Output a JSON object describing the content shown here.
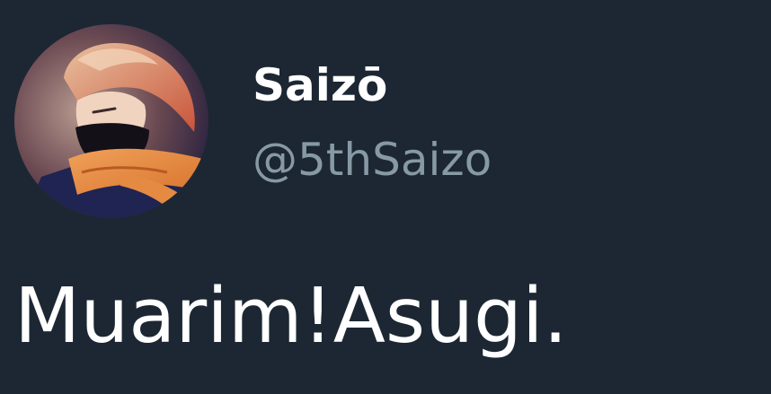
{
  "theme": {
    "background": "#1c2733",
    "name_color": "#ffffff",
    "handle_color": "#8899a6",
    "text_color": "#ffffff"
  },
  "author": {
    "avatar_icon": "profile-avatar-illustration",
    "display_name": "Saizō",
    "handle": "@5thSaizo"
  },
  "tweet": {
    "text": "Muarim!Asugi."
  }
}
